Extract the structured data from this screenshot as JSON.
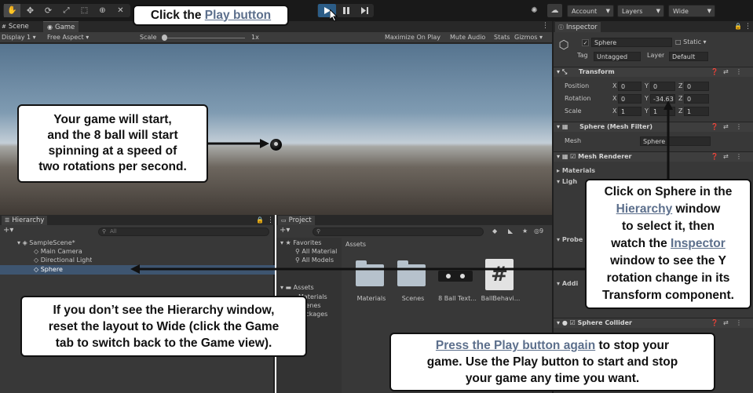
{
  "toolbar": {
    "account_label": "Account",
    "layers_label": "Layers",
    "layout_label": "Wide",
    "tools": [
      "hand-tool-icon",
      "move-tool-icon",
      "rotate-tool-icon",
      "scale-tool-icon",
      "rect-tool-icon",
      "transform-tool-icon",
      "custom-tool-icon"
    ]
  },
  "tabs": {
    "scene": "Scene",
    "game": "Game",
    "inspector": "Inspector",
    "hierarchy": "Hierarchy",
    "project": "Project"
  },
  "game_bar": {
    "display": "Display 1",
    "aspect": "Free Aspect",
    "scale_label": "Scale",
    "scale_value": "1x",
    "maximize": "Maximize On Play",
    "mute": "Mute Audio",
    "stats": "Stats",
    "gizmos": "Gizmos"
  },
  "hierarchy": {
    "search_placeholder": "All",
    "scene_name": "SampleScene*",
    "items": [
      "Main Camera",
      "Directional Light",
      "Sphere"
    ]
  },
  "project": {
    "favorites_label": "Favorites",
    "favorites": [
      "All Material",
      "All Models"
    ],
    "assets_root": "Assets",
    "tree": [
      "Materials",
      "Scenes",
      "Packages"
    ],
    "breadcrumb": "Assets",
    "count": "9",
    "assets": [
      {
        "name": "Materials",
        "icon": "folder-icon"
      },
      {
        "name": "Scenes",
        "icon": "folder-icon"
      },
      {
        "name": "8 Ball Text...",
        "icon": "texture-icon"
      },
      {
        "name": "BallBehavi...",
        "icon": "script-icon"
      }
    ]
  },
  "inspector": {
    "object_name": "Sphere",
    "static_label": "Static",
    "tag_label": "Tag",
    "tag_value": "Untagged",
    "layer_label": "Layer",
    "layer_value": "Default",
    "transform": {
      "title": "Transform",
      "position_label": "Position",
      "rotation_label": "Rotation",
      "scale_label": "Scale",
      "position": {
        "x": "0",
        "y": "0",
        "z": "0"
      },
      "rotation": {
        "x": "0",
        "y": "-34.63",
        "z": "0"
      },
      "scale": {
        "x": "1",
        "y": "1",
        "z": "1"
      }
    },
    "mesh_filter": {
      "title": "Sphere (Mesh Filter)",
      "mesh_label": "Mesh",
      "mesh_value": "Sphere"
    },
    "mesh_renderer": {
      "title": "Mesh Renderer",
      "materials": "Materials",
      "lighting": "Ligh",
      "probes": "Probe",
      "additional": "Addi"
    },
    "sphere_collider": {
      "title": "Sphere Collider"
    }
  },
  "callouts": {
    "play_prefix": "Click the ",
    "play_link": "Play button",
    "game_start": [
      "Your game will start,",
      "and the 8 ball will start",
      "spinning at a speed of",
      "two rotations per second."
    ],
    "hierarchy_note": [
      "If you don’t see the Hierarchy window,",
      "reset the layout to Wide (click the Game",
      "tab to switch back to the Game view)."
    ],
    "sphere_line1": "Click on Sphere in the",
    "sphere_link1": "Hierarchy",
    "sphere_line2_rest": " window",
    "sphere_line3": "to select it, then",
    "sphere_line4_prefix": "watch the ",
    "sphere_link2": "Inspector",
    "sphere_line5": "window to see the Y",
    "sphere_line6": "rotation change in its",
    "sphere_line7": "Transform component.",
    "stop_link": "Press the Play button again",
    "stop_rest": " to stop your",
    "stop_line2": "game. Use the Play button to start and stop",
    "stop_line3": "your game any time you want."
  },
  "colors": {
    "editor_bg": "#383838",
    "toolbar_bg": "#191919",
    "panel_bg": "#383838",
    "selection": "#2c5d87",
    "link": "#5c6f8c",
    "arrow": "#111111"
  }
}
